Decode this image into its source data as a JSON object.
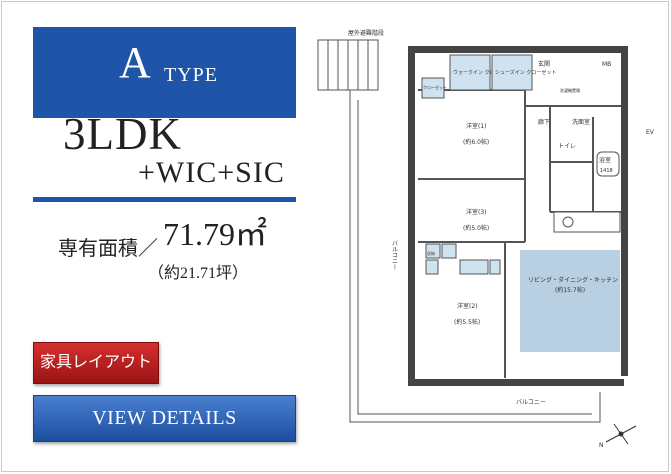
{
  "type_banner": {
    "letter": "A",
    "word": "TYPE"
  },
  "layout": {
    "main": "3LDK",
    "sub": "+WIC+SIC"
  },
  "area": {
    "label": "専有面積／",
    "value": "71.79㎡",
    "tsubo": "（約21.71坪）"
  },
  "buttons": {
    "furniture": "家具レイアウト",
    "details": "VIEW DETAILS"
  },
  "floorplan": {
    "top_label": "屋外避難階段",
    "entrance": "玄関",
    "mb": "MB",
    "ev": "EV",
    "hall": "廊下",
    "washroom": "洗面室",
    "washer": "洗濯機置場",
    "toilet": "トイレ",
    "bath": "浴室",
    "bath_size": "1418",
    "walkin_closet": "ウォークイン\nクローゼット",
    "shoes_closet": "シューズイン\nクローゼット",
    "closet": "クローゼット",
    "room1": "洋室(1)",
    "room1_size": "(約6.0帖)",
    "room3": "洋室(3)",
    "room3_size": "(約5.0帖)",
    "room2": "洋室(2)",
    "room2_size": "(約5.5帖)",
    "ldk": "リビング・ダイニング・キッチン",
    "ldk_size": "(約15.7帖)",
    "balcony_side": "バルコニー",
    "balcony_bottom": "バルコニー",
    "storage": "収納",
    "north": "N"
  }
}
